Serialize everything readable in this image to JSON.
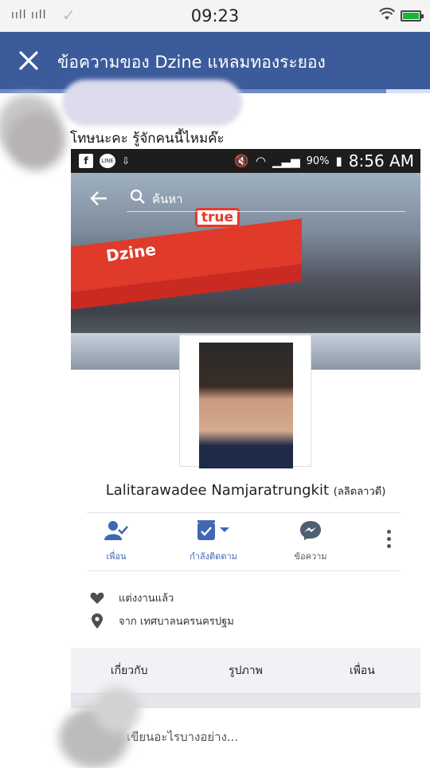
{
  "status_bar": {
    "signal": "ııll ııll",
    "time": "09:23",
    "battery_color": "#19b53a"
  },
  "header": {
    "title": "ข้อความของ Dzine แหลมทองระยอง",
    "bg_color": "#3c5b9b"
  },
  "message": {
    "text": "โทษนะคะ รู้จักคนนี้ไหมค๊ะ"
  },
  "embedded": {
    "status_bar": {
      "fb_icon": "f",
      "line_icon": "LINE",
      "battery": "90%",
      "time": "8:56 AM"
    },
    "search": {
      "placeholder": "ค้นหา"
    },
    "cover_signs": {
      "brand": "Dzine",
      "carrier": "true"
    },
    "profile": {
      "name": "Lalitarawadee Namjaratrungkit",
      "alt_name": "(ลลิตลาวดี)"
    },
    "actions": [
      {
        "label": "เพื่อน",
        "icon": "friend-check-icon"
      },
      {
        "label": "กำลังติดตาม",
        "icon": "following-icon"
      },
      {
        "label": "ข้อความ",
        "icon": "messenger-icon"
      }
    ],
    "info": [
      {
        "text": "แต่งงานแล้ว",
        "icon": "heart-icon"
      },
      {
        "text": "จาก เทศบาลนครนครปฐม",
        "icon": "location-pin-icon"
      }
    ],
    "tabs": [
      "เกี่ยวกับ",
      "รูปภาพ",
      "เพื่อน"
    ],
    "composer": {
      "placeholder": "เขียนอะไรบางอย่าง..."
    }
  }
}
